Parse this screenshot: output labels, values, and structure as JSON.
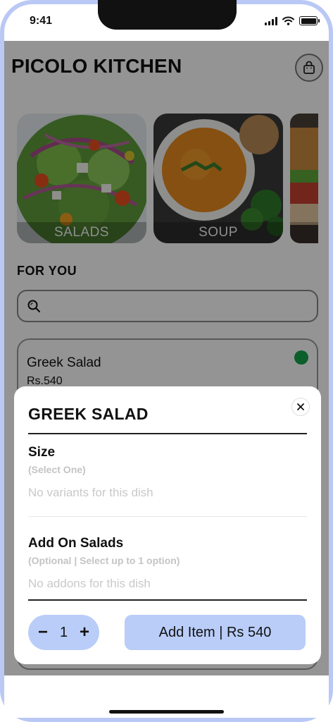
{
  "status_bar": {
    "time": "9:41"
  },
  "app": {
    "title": "PICOLO KITCHEN",
    "categories": [
      {
        "label": "SALADS"
      },
      {
        "label": "SOUP"
      },
      {
        "label": ""
      }
    ],
    "section_title": "FOR YOU",
    "search": {
      "placeholder": ""
    },
    "dish": {
      "name": "Greek Salad",
      "price": "Rs.540"
    }
  },
  "modal": {
    "title": "GREEK SALAD",
    "size": {
      "title": "Size",
      "hint": "(Select One)",
      "empty": "No variants for this dish"
    },
    "addons": {
      "title": "Add On Salads",
      "hint": "(Optional | Select up to 1 option)",
      "empty": "No addons for this dish"
    },
    "quantity": {
      "minus": "−",
      "value": "1",
      "plus": "+"
    },
    "add_button": "Add Item | Rs 540"
  },
  "colors": {
    "accent": "#b9cdf8",
    "frame": "#b9c8f5",
    "veg": "#15a34a"
  }
}
